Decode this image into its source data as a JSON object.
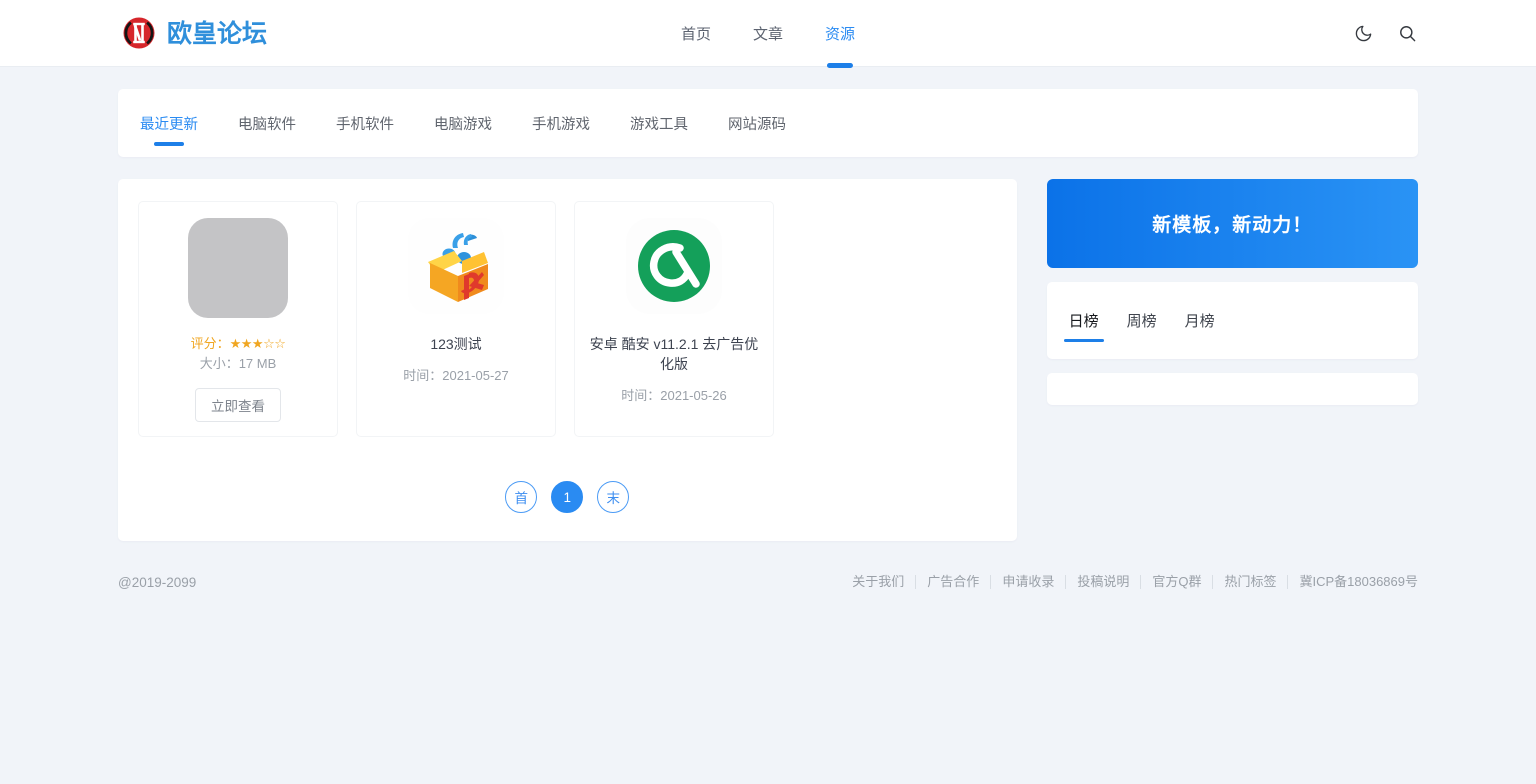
{
  "site": {
    "logo_text": "欧皇论坛",
    "logo_icon": "ou-huang-emblem-icon"
  },
  "header": {
    "nav": [
      {
        "label": "首页",
        "active": false
      },
      {
        "label": "文章",
        "active": false
      },
      {
        "label": "资源",
        "active": true
      }
    ],
    "actions": [
      {
        "name": "dark-mode-toggle",
        "icon": "moon-icon"
      },
      {
        "name": "search-button",
        "icon": "search-icon"
      }
    ]
  },
  "categories": {
    "tabs": [
      {
        "label": "最近更新",
        "active": true
      },
      {
        "label": "电脑软件",
        "active": false
      },
      {
        "label": "手机软件",
        "active": false
      },
      {
        "label": "电脑游戏",
        "active": false
      },
      {
        "label": "手机游戏",
        "active": false
      },
      {
        "label": "游戏工具",
        "active": false
      },
      {
        "label": "网站源码",
        "active": false
      }
    ]
  },
  "resources": [
    {
      "thumb": "gray-placeholder-icon",
      "title": "",
      "rating_label": "评分：",
      "rating_stars": "★★★☆☆",
      "rating_value": 3,
      "size_text": "大小：17 MB",
      "button_label": "立即查看"
    },
    {
      "thumb": "kugou-music-box-icon",
      "title": "123测试",
      "time_text": "时间：2021-05-27"
    },
    {
      "thumb": "coolapk-icon",
      "title": "安卓 酷安 v11.2.1 去广告优化版",
      "time_text": "时间：2021-05-26"
    }
  ],
  "pagination": {
    "first_label": "首",
    "current_label": "1",
    "last_label": "末"
  },
  "sidebar": {
    "promo": {
      "text": "新模板，新动力！"
    },
    "rank_tabs": [
      {
        "label": "日榜",
        "active": true
      },
      {
        "label": "周榜",
        "active": false
      },
      {
        "label": "月榜",
        "active": false
      }
    ]
  },
  "footer": {
    "copyright": "@2019-2099",
    "links": [
      "关于我们",
      "广告合作",
      "申请收录",
      "投稿说明",
      "官方Q群",
      "热门标签",
      "冀ICP备18036869号"
    ]
  },
  "colors": {
    "accent": "#2a8bf2",
    "accent_dark": "#1d7fe8",
    "page_bg": "#f1f4f9",
    "star": "#f0a621",
    "logo_blue": "#2f8fdb",
    "logo_red": "#d6262b"
  }
}
